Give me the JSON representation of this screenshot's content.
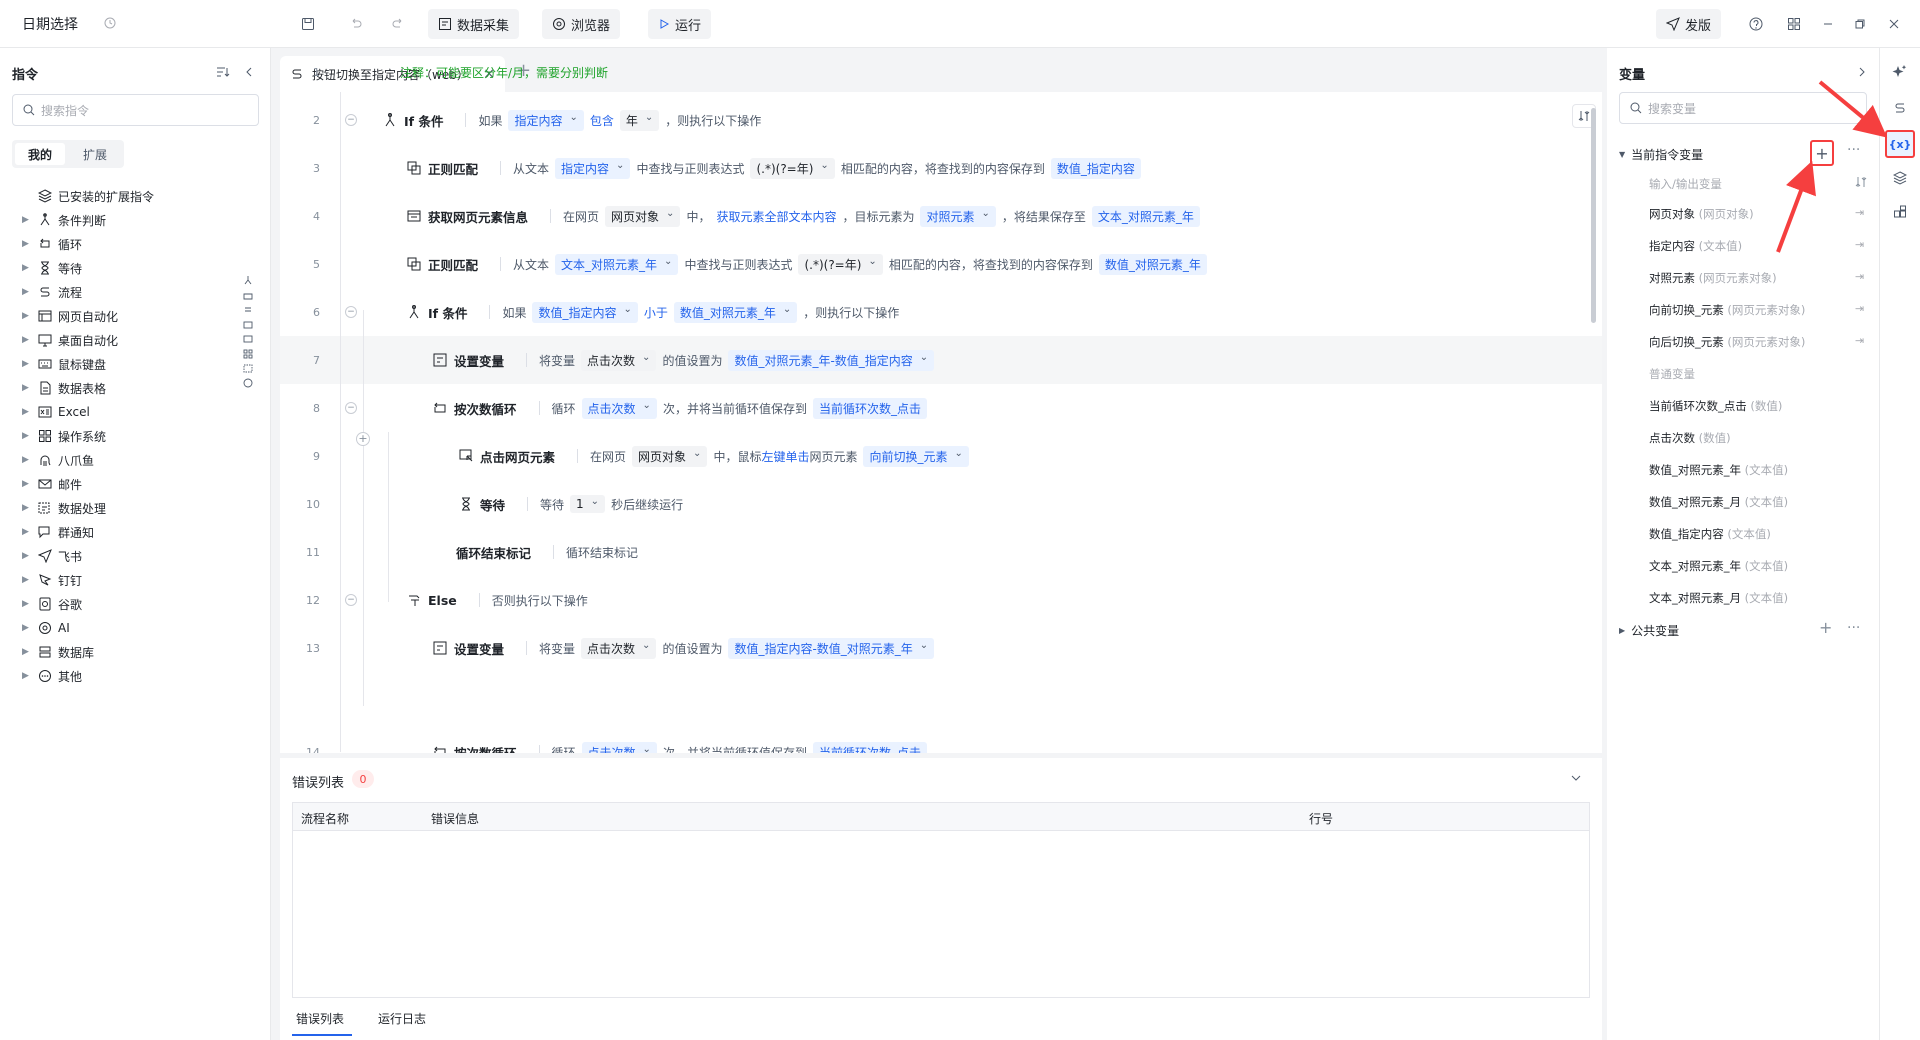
{
  "app": {
    "title": "日期选择"
  },
  "toolbar": {
    "collect": "数据采集",
    "browser": "浏览器",
    "run": "运行",
    "publish": "发版"
  },
  "left": {
    "header": "指令",
    "search_placeholder": "搜索指令",
    "tabs": [
      "我的",
      "扩展"
    ],
    "items": [
      "已安装的扩展指令",
      "条件判断",
      "循环",
      "等待",
      "流程",
      "网页自动化",
      "桌面自动化",
      "鼠标键盘",
      "数据表格",
      "Excel",
      "操作系统",
      "八爪鱼",
      "邮件",
      "数据处理",
      "群通知",
      "飞书",
      "钉钉",
      "谷歌",
      "AI",
      "数据库",
      "其他"
    ]
  },
  "editor": {
    "tab_title": "按钮切换至指定内容（web）",
    "lines": {
      "l1": {
        "comment": "注释：可能要区分年/月，需要分别判断"
      },
      "l2": {
        "cmd": "If 条件",
        "t1": "如果",
        "v1": "指定内容",
        "op": "包含",
        "v2": "年",
        "t2": "，则执行以下操作"
      },
      "l3": {
        "cmd": "正则匹配",
        "t1": "从文本",
        "v1": "指定内容",
        "t2": "中查找与正则表达式",
        "v2": "(.*)(?=年)",
        "t3": "相匹配的内容，将查找到的内容保存到",
        "v3": "数值_指定内容"
      },
      "l4": {
        "cmd": "获取网页元素信息",
        "t1": "在网页",
        "v1": "网页对象",
        "t2": "中，",
        "v2": "获取元素全部文本内容",
        "t3": "，目标元素为",
        "v3": "对照元素",
        "t4": "，将结果保存至",
        "v4": "文本_对照元素_年"
      },
      "l5": {
        "cmd": "正则匹配",
        "t1": "从文本",
        "v1": "文本_对照元素_年",
        "t2": "中查找与正则表达式",
        "v2": "(.*)(?=年)",
        "t3": "相匹配的内容，将查找到的内容保存到",
        "v3": "数值_对照元素_年"
      },
      "l6": {
        "cmd": "If 条件",
        "t1": "如果",
        "v1": "数值_指定内容",
        "op": "小于",
        "v2": "数值_对照元素_年",
        "t2": "，则执行以下操作"
      },
      "l7": {
        "cmd": "设置变量",
        "t1": "将变量",
        "v1": "点击次数",
        "t2": "的值设置为",
        "v2": "数值_对照元素_年-数值_指定内容"
      },
      "l8": {
        "cmd": "按次数循环",
        "t1": "循环",
        "v1": "点击次数",
        "t2": "次，并将当前循环值保存到",
        "v2": "当前循环次数_点击"
      },
      "l9": {
        "cmd": "点击网页元素",
        "t1": "在网页",
        "v1": "网页对象",
        "t2": "中，鼠标",
        "v2": "左键单击",
        "t3": "网页元素",
        "v3": "向前切换_元素"
      },
      "l10": {
        "cmd": "等待",
        "t1": "等待",
        "v1": "1",
        "t2": "秒后继续运行"
      },
      "l11": {
        "cmd": "循环结束标记",
        "t1": "循环结束标记"
      },
      "l12": {
        "cmd": "Else",
        "t1": "否则执行以下操作"
      },
      "l13": {
        "cmd": "设置变量",
        "t1": "将变量",
        "v1": "点击次数",
        "t2": "的值设置为",
        "v2": "数值_指定内容-数值_对照元素_年"
      },
      "l14": {
        "cmd": "按次数循环",
        "t1": "循环",
        "v1": "点击次数",
        "t2": "次，并将当前循环值保存到",
        "v2": "当前循环次数_点击"
      }
    }
  },
  "errors": {
    "title": "错误列表",
    "count": "0",
    "col_name": "流程名称",
    "col_info": "错误信息",
    "col_line": "行号",
    "tab1": "错误列表",
    "tab2": "运行日志"
  },
  "vars": {
    "title": "变量",
    "search_placeholder": "搜索变量",
    "current_group": "当前指令变量",
    "io_label": "输入/输出变量",
    "io": [
      {
        "name": "网页对象",
        "type": "(网页对象)"
      },
      {
        "name": "指定内容",
        "type": "(文本值)"
      },
      {
        "name": "对照元素",
        "type": "(网页元素对象)"
      },
      {
        "name": "向前切换_元素",
        "type": "(网页元素对象)"
      },
      {
        "name": "向后切换_元素",
        "type": "(网页元素对象)"
      }
    ],
    "normal_label": "普通变量",
    "normal": [
      {
        "name": "当前循环次数_点击",
        "type": "(数值)"
      },
      {
        "name": "点击次数",
        "type": "(数值)"
      },
      {
        "name": "数值_对照元素_年",
        "type": "(文本值)"
      },
      {
        "name": "数值_对照元素_月",
        "type": "(文本值)"
      },
      {
        "name": "数值_指定内容",
        "type": "(文本值)"
      },
      {
        "name": "文本_对照元素_年",
        "type": "(文本值)"
      },
      {
        "name": "文本_对照元素_月",
        "type": "(文本值)"
      }
    ],
    "public_group": "公共变量",
    "rail_var_label": "{x}"
  }
}
